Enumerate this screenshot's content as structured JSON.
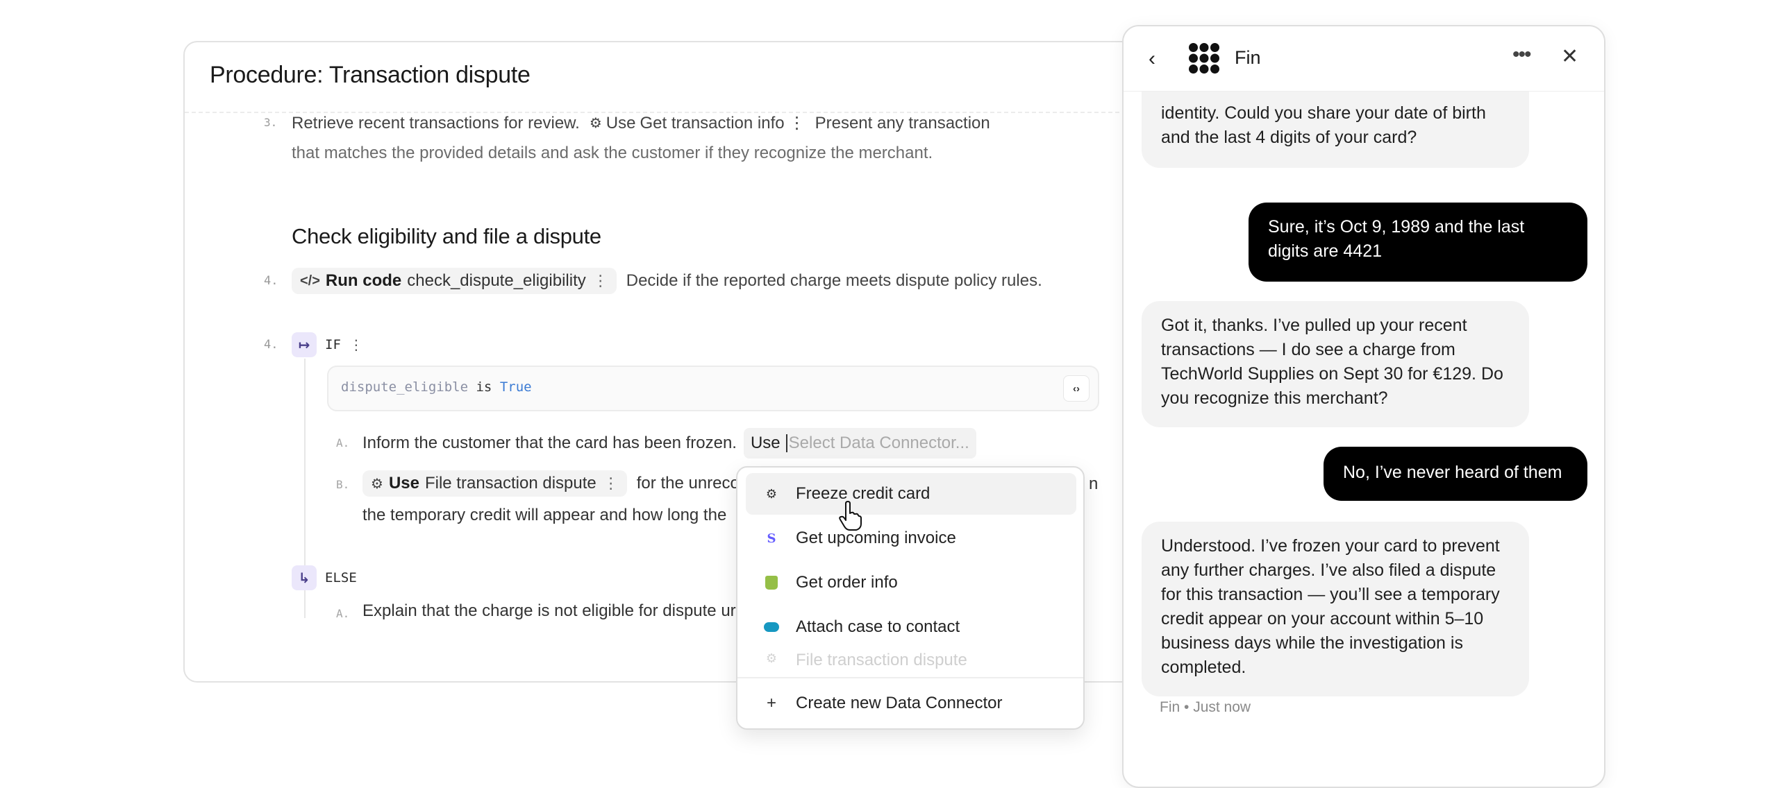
{
  "procedure": {
    "title": "Procedure: Transaction dispute",
    "step3": {
      "number": "3.",
      "text_before": "Retrieve recent transactions for review.",
      "chip_use": "Use",
      "chip_name": "Get transaction info",
      "text_after": "Present any transaction",
      "line2": "that matches the provided details and ask the customer if they recognize the merchant."
    },
    "section_heading": "Check eligibility and file a dispute",
    "step4": {
      "number": "4.",
      "chip_bold": "Run code",
      "chip_name": "check_dispute_eligibility",
      "text": "Decide if the reported charge meets dispute policy rules."
    },
    "if_block": {
      "number": "4.",
      "label": "IF",
      "condition_var": "dispute_eligible",
      "condition_op": "is",
      "condition_val": "True",
      "sub_a": {
        "letter": "A.",
        "text": "Inform the customer that the card has been frozen.",
        "input_use": "Use",
        "input_placeholder": "Select Data Connector..."
      },
      "sub_b": {
        "letter": "B.",
        "chip_bold": "Use",
        "chip_name": "File transaction dispute",
        "text_after": "for the unrecog",
        "text_tail": "n",
        "line2": "the temporary credit will appear and how long the"
      }
    },
    "else_block": {
      "label": "ELSE",
      "sub_a": {
        "letter": "A.",
        "text": "Explain that the charge is not eligible for dispute ur"
      }
    }
  },
  "dropdown": {
    "items": [
      {
        "label": "Freeze credit card",
        "icon": "webhook-icon",
        "active": true
      },
      {
        "label": "Get upcoming invoice",
        "icon": "stripe-icon",
        "color": "#635bff"
      },
      {
        "label": "Get order info",
        "icon": "shopify-icon",
        "color": "#95bf47"
      },
      {
        "label": "Attach case to contact",
        "icon": "salesforce-icon",
        "color": "#1798c1"
      },
      {
        "label": "File transaction dispute",
        "icon": "webhook-icon",
        "faded": true
      }
    ],
    "create_label": "Create new Data Connector"
  },
  "chat": {
    "title": "Fin",
    "messages": [
      {
        "from": "bot",
        "text": "identity. Could you share your date of birth and the last 4 digits of your card?"
      },
      {
        "from": "user",
        "text": "Sure, it’s Oct 9, 1989 and the last digits are 4421"
      },
      {
        "from": "bot",
        "text": "Got it, thanks. I’ve pulled up your recent transactions — I do see a charge from TechWorld Supplies on Sept 30 for €129. Do you recognize this merchant?"
      },
      {
        "from": "user",
        "text": "No, I’ve never heard of them"
      },
      {
        "from": "bot",
        "text": "Understood. I’ve frozen your card to prevent any further charges. I’ve also filed a dispute for this transaction — you’ll see a temporary credit appear on your account within 5–10 business days while the investigation is completed."
      }
    ],
    "meta": "Fin • Just now"
  }
}
